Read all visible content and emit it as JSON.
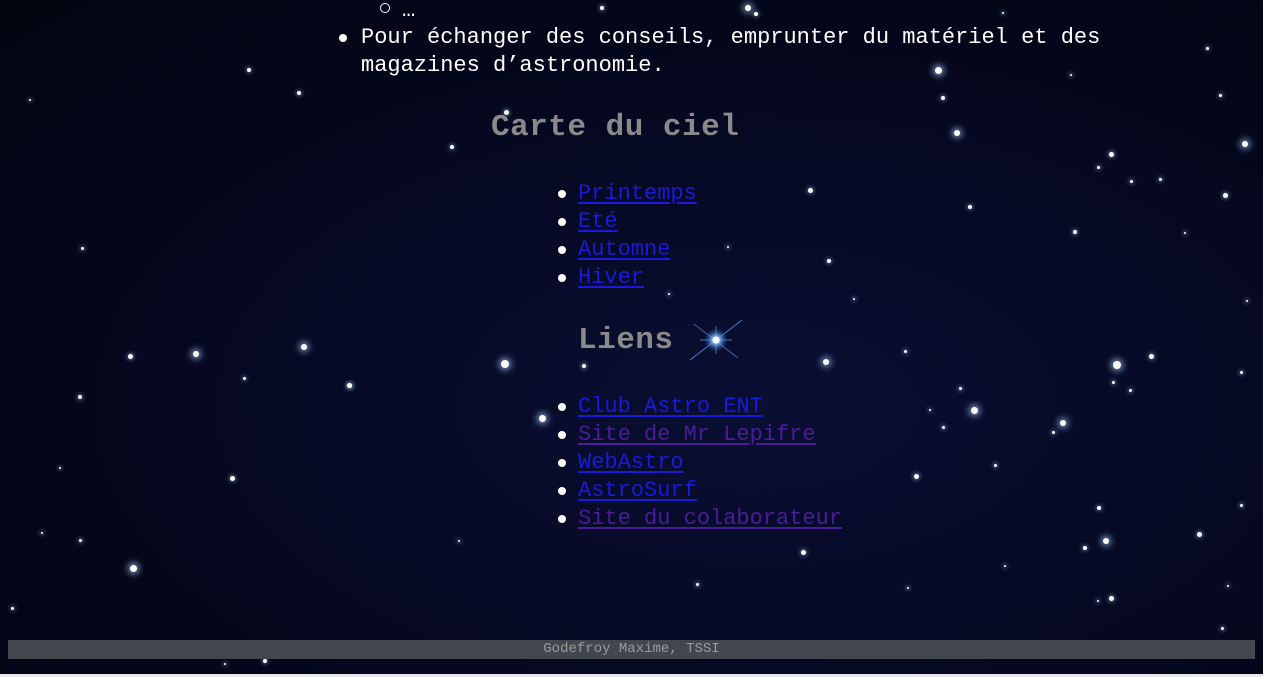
{
  "intro": {
    "sub_item": "…",
    "text": "Pour échanger des conseils, emprunter du matériel et des magazines d’astronomie."
  },
  "sky_map": {
    "title": "Carte du ciel",
    "items": [
      {
        "label": "Printemps",
        "visited": false
      },
      {
        "label": "Eté",
        "visited": false
      },
      {
        "label": "Automne",
        "visited": false
      },
      {
        "label": "Hiver",
        "visited": false
      }
    ]
  },
  "links": {
    "title": "Liens",
    "items": [
      {
        "label": "Club Astro ENT",
        "visited": false
      },
      {
        "label": "Site de Mr Lepifre",
        "visited": true
      },
      {
        "label": "WebAstro",
        "visited": false
      },
      {
        "label": "AstroSurf",
        "visited": false
      },
      {
        "label": "Site du colaborateur",
        "visited": true
      }
    ]
  },
  "footer": {
    "text": "Godefroy Maxime, TSSI"
  },
  "colors": {
    "background": "#04071c",
    "heading": "#8a8a8a",
    "link": "#1a1ad8",
    "link_visited": "#4a1c9a",
    "footer_bg": "#44464e",
    "footer_text": "#9a9a9a"
  }
}
